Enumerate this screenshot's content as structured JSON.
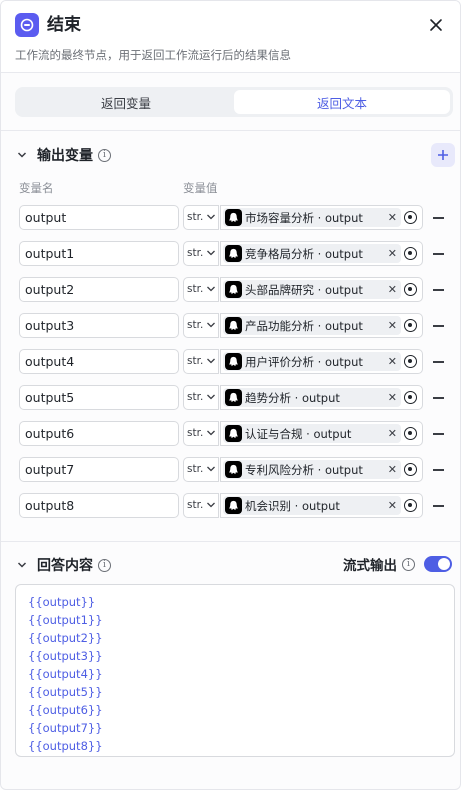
{
  "header": {
    "title": "结束",
    "description": "工作流的最终节点，用于返回工作流运行后的结果信息"
  },
  "tabs": [
    {
      "label": "返回变量",
      "active": false
    },
    {
      "label": "返回文本",
      "active": true
    }
  ],
  "output_section": {
    "title": "输出变量",
    "col_name": "变量名",
    "col_value": "变量值"
  },
  "rows": [
    {
      "name": "output",
      "type": "str.",
      "ref": "市场容量分析 · output"
    },
    {
      "name": "output1",
      "type": "str.",
      "ref": "竞争格局分析 · output"
    },
    {
      "name": "output2",
      "type": "str.",
      "ref": "头部品牌研究 · output"
    },
    {
      "name": "output3",
      "type": "str.",
      "ref": "产品功能分析 · output"
    },
    {
      "name": "output4",
      "type": "str.",
      "ref": "用户评价分析 · output"
    },
    {
      "name": "output5",
      "type": "str.",
      "ref": "趋势分析 · output"
    },
    {
      "name": "output6",
      "type": "str.",
      "ref": "认证与合规 · output"
    },
    {
      "name": "output7",
      "type": "str.",
      "ref": "专利风险分析 · output"
    },
    {
      "name": "output8",
      "type": "str.",
      "ref": "机会识别 · output"
    }
  ],
  "answer_section": {
    "title": "回答内容",
    "stream_label": "流式输出",
    "stream_enabled": true,
    "lines": [
      "{{output}}",
      "{{output1}}",
      "{{output2}}",
      "{{output3}}",
      "{{output4}}",
      "{{output5}}",
      "{{output6}}",
      "{{output7}}",
      "{{output8}}"
    ]
  },
  "colors": {
    "accent": "#4e5ee4",
    "node_icon": "#5b5cf0"
  }
}
